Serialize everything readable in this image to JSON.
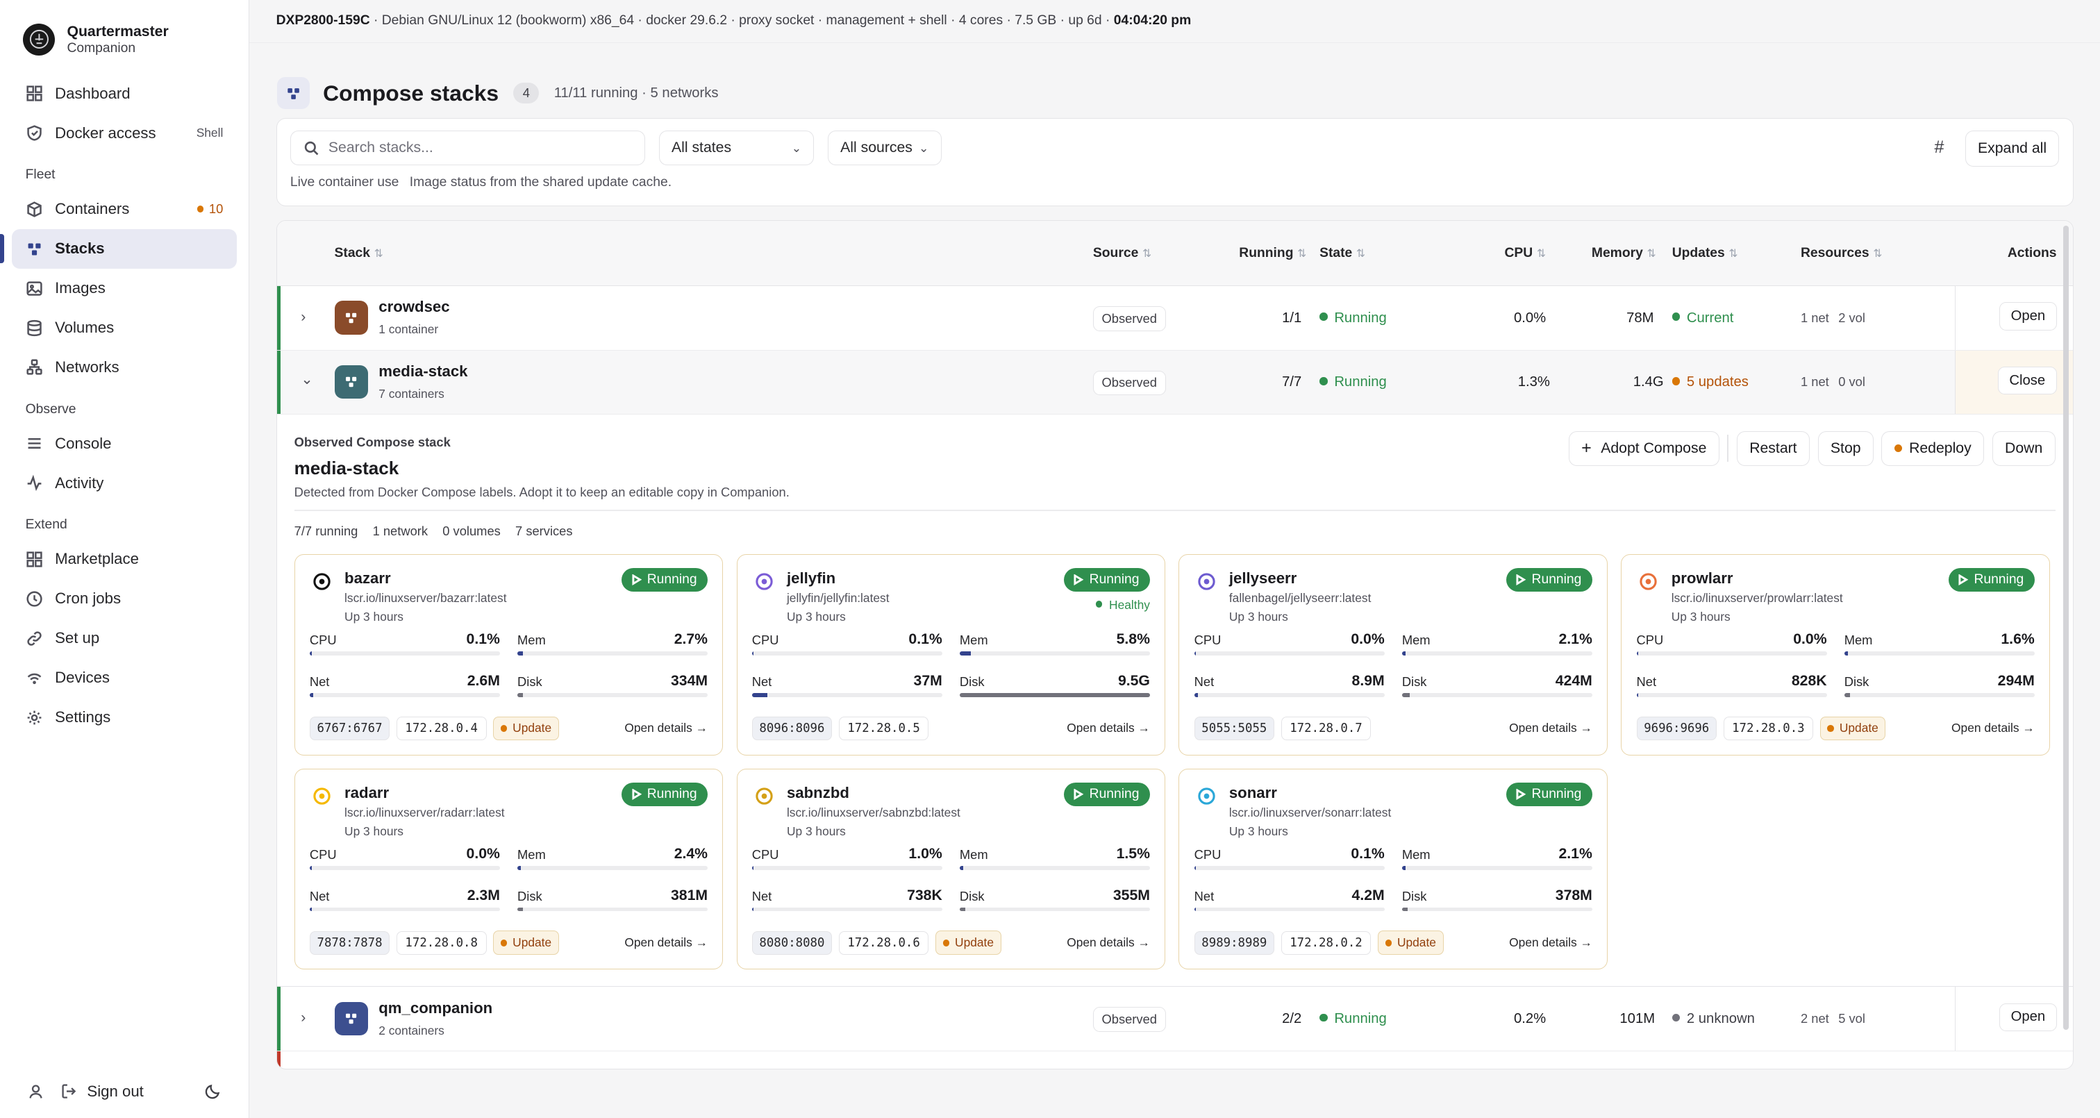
{
  "brand": {
    "name": "Quartermaster",
    "sub": "Companion"
  },
  "nav": {
    "dashboard": "Dashboard",
    "docker_access": "Docker access",
    "docker_access_aux": "Shell",
    "fleet_label": "Fleet",
    "containers": "Containers",
    "containers_badge": "10",
    "stacks": "Stacks",
    "images": "Images",
    "volumes": "Volumes",
    "networks": "Networks",
    "observe_label": "Observe",
    "console": "Console",
    "activity": "Activity",
    "extend_label": "Extend",
    "marketplace": "Marketplace",
    "cron_jobs": "Cron jobs",
    "set_up": "Set up",
    "devices": "Devices",
    "settings": "Settings",
    "sign_out": "Sign out"
  },
  "topbar": {
    "host": "DXP2800-159C",
    "info": "· Debian GNU/Linux 12 (bookworm) x86_64 · docker 29.6.2 · proxy socket · management + shell · 4 cores · 7.5 GB · up 6d ·",
    "time": "04:04:20 pm"
  },
  "page": {
    "title": "Compose stacks",
    "count": "4",
    "sub": "11/11 running · 5 networks"
  },
  "filters": {
    "search_placeholder": "Search stacks...",
    "states": "All states",
    "sources": "All sources",
    "expand_all": "Expand all",
    "note1": "Live container use",
    "note2": "Image status from the shared update cache."
  },
  "table": {
    "headers": {
      "stack": "Stack",
      "source": "Source",
      "running": "Running",
      "state": "State",
      "cpu": "CPU",
      "memory": "Memory",
      "updates": "Updates",
      "resources": "Resources",
      "actions": "Actions"
    },
    "rows": [
      {
        "name": "crowdsec",
        "containers": "1 container",
        "source": "Observed",
        "running": "1/1",
        "state": "Running",
        "cpu": "0.0%",
        "memory": "78M",
        "updates": "Current",
        "net": "1 net",
        "vol": "2 vol",
        "action": "Open"
      },
      {
        "name": "media-stack",
        "containers": "7 containers",
        "source": "Observed",
        "running": "7/7",
        "state": "Running",
        "cpu": "1.3%",
        "memory": "1.4G",
        "updates": "5 updates",
        "net": "1 net",
        "vol": "0 vol",
        "action": "Close"
      },
      {
        "name": "qm_companion",
        "containers": "2 containers",
        "source": "Observed",
        "running": "2/2",
        "state": "Running",
        "cpu": "0.2%",
        "memory": "101M",
        "updates": "2 unknown",
        "net": "2 net",
        "vol": "5 vol",
        "action": "Open"
      }
    ]
  },
  "detail": {
    "kicker": "Observed Compose stack",
    "title": "media-stack",
    "desc": "Detected from Docker Compose labels. Adopt it to keep an editable copy in Companion.",
    "buttons": {
      "adopt": "Adopt Compose",
      "restart": "Restart",
      "stop": "Stop",
      "redeploy": "Redeploy",
      "down": "Down"
    },
    "stats": {
      "running": "7/7 running",
      "network": "1 network",
      "volumes": "0 volumes",
      "services": "7 services"
    }
  },
  "labels": {
    "cpu": "CPU",
    "mem": "Mem",
    "net": "Net",
    "disk": "Disk",
    "running": "Running",
    "update": "Update",
    "open_details": "Open details →",
    "healthy": "Healthy"
  },
  "cards": [
    {
      "name": "bazarr",
      "image": "lscr.io/linuxserver/bazarr:latest",
      "uptime": "Up 3 hours",
      "cpu": "0.1%",
      "cpu_pct": 1,
      "mem": "2.7%",
      "mem_pct": 3,
      "net": "2.6M",
      "net_pct": 2,
      "disk": "334M",
      "disk_pct": 3,
      "port": "6767:6767",
      "ip": "172.28.0.4",
      "update": true,
      "healthy": false,
      "icon": "bazarr-icon",
      "color": "#111111"
    },
    {
      "name": "jellyfin",
      "image": "jellyfin/jellyfin:latest",
      "uptime": "Up 3 hours",
      "cpu": "0.1%",
      "cpu_pct": 1,
      "mem": "5.8%",
      "mem_pct": 6,
      "net": "37M",
      "net_pct": 8,
      "disk": "9.5G",
      "disk_pct": 100,
      "port": "8096:8096",
      "ip": "172.28.0.5",
      "update": false,
      "healthy": true,
      "icon": "jellyfin-icon",
      "color": "#7b5cd6"
    },
    {
      "name": "jellyseerr",
      "image": "fallenbagel/jellyseerr:latest",
      "uptime": "Up 3 hours",
      "cpu": "0.0%",
      "cpu_pct": 0,
      "mem": "2.1%",
      "mem_pct": 2,
      "net": "8.9M",
      "net_pct": 2,
      "disk": "424M",
      "disk_pct": 4,
      "port": "5055:5055",
      "ip": "172.28.0.7",
      "update": false,
      "healthy": false,
      "icon": "jellyseerr-icon",
      "color": "#6d5bd0"
    },
    {
      "name": "prowlarr",
      "image": "lscr.io/linuxserver/prowlarr:latest",
      "uptime": "Up 3 hours",
      "cpu": "0.0%",
      "cpu_pct": 0,
      "mem": "1.6%",
      "mem_pct": 2,
      "net": "828K",
      "net_pct": 0,
      "disk": "294M",
      "disk_pct": 3,
      "port": "9696:9696",
      "ip": "172.28.0.3",
      "update": true,
      "healthy": false,
      "icon": "prowlarr-icon",
      "color": "#e8703a"
    },
    {
      "name": "radarr",
      "image": "lscr.io/linuxserver/radarr:latest",
      "uptime": "Up 3 hours",
      "cpu": "0.0%",
      "cpu_pct": 0,
      "mem": "2.4%",
      "mem_pct": 2,
      "net": "2.3M",
      "net_pct": 1,
      "disk": "381M",
      "disk_pct": 3,
      "port": "7878:7878",
      "ip": "172.28.0.8",
      "update": true,
      "healthy": false,
      "icon": "radarr-icon",
      "color": "#f5b800"
    },
    {
      "name": "sabnzbd",
      "image": "lscr.io/linuxserver/sabnzbd:latest",
      "uptime": "Up 3 hours",
      "cpu": "1.0%",
      "cpu_pct": 1,
      "mem": "1.5%",
      "mem_pct": 2,
      "net": "738K",
      "net_pct": 0,
      "disk": "355M",
      "disk_pct": 3,
      "port": "8080:8080",
      "ip": "172.28.0.6",
      "update": true,
      "healthy": false,
      "icon": "sabnzbd-icon",
      "color": "#d4a017"
    },
    {
      "name": "sonarr",
      "image": "lscr.io/linuxserver/sonarr:latest",
      "uptime": "Up 3 hours",
      "cpu": "0.1%",
      "cpu_pct": 1,
      "mem": "2.1%",
      "mem_pct": 2,
      "net": "4.2M",
      "net_pct": 1,
      "disk": "378M",
      "disk_pct": 3,
      "port": "8989:8989",
      "ip": "172.28.0.2",
      "update": true,
      "healthy": false,
      "icon": "sonarr-icon",
      "color": "#2aa7d8"
    }
  ],
  "colors": {
    "accent": "#33438d",
    "running": "#2f8f4e",
    "warning": "#d97706",
    "crowdsec": "#8a4b2a",
    "media": "#3d6b73",
    "qm": "#3c4f8f"
  }
}
